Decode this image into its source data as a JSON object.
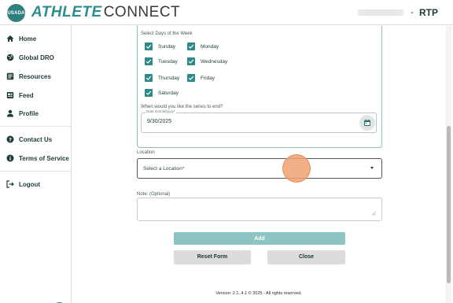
{
  "header": {
    "logo_badge_text": "USADA",
    "brand_part1": "ATHLETE",
    "brand_part2": "CONNECT",
    "user_separator": "-",
    "user_code": "RTP"
  },
  "sidebar": {
    "items": [
      {
        "label": "Home",
        "icon": "home-icon"
      },
      {
        "label": "Global DRO",
        "icon": "globe-icon"
      },
      {
        "label": "Resources",
        "icon": "resources-icon"
      },
      {
        "label": "Feed",
        "icon": "feed-icon"
      },
      {
        "label": "Profile",
        "icon": "person-icon"
      },
      {
        "label": "Contact Us",
        "icon": "question-icon"
      },
      {
        "label": "Terms of Service",
        "icon": "info-icon"
      },
      {
        "label": "Logout",
        "icon": "logout-icon"
      }
    ]
  },
  "form": {
    "days_title": "Select Days of the Week",
    "days": [
      {
        "label": "Sunday",
        "checked": true
      },
      {
        "label": "Monday",
        "checked": true
      },
      {
        "label": "Tuesday",
        "checked": true
      },
      {
        "label": "Wednesday",
        "checked": true
      },
      {
        "label": "Thursday",
        "checked": true
      },
      {
        "label": "Friday",
        "checked": true
      },
      {
        "label": "Saturday",
        "checked": true
      }
    ],
    "series_end_question": "When would you like the series to end?",
    "date_legend": "Date mm/dd/yyyy*",
    "date_value": "9/30/2025",
    "location_label": "Location",
    "location_placeholder": "Select a Location*",
    "note_label": "Note: (Optional)",
    "note_value": "",
    "add_label": "Add",
    "reset_label": "Reset Form",
    "close_label": "Close"
  },
  "footer": {
    "text": "Version: 2.1..4.1 © 2025 - All rights reserved."
  },
  "colors": {
    "accent": "#2e8a8a",
    "add_button": "#8cc3c3",
    "tap_indicator": "#f0a06e"
  }
}
